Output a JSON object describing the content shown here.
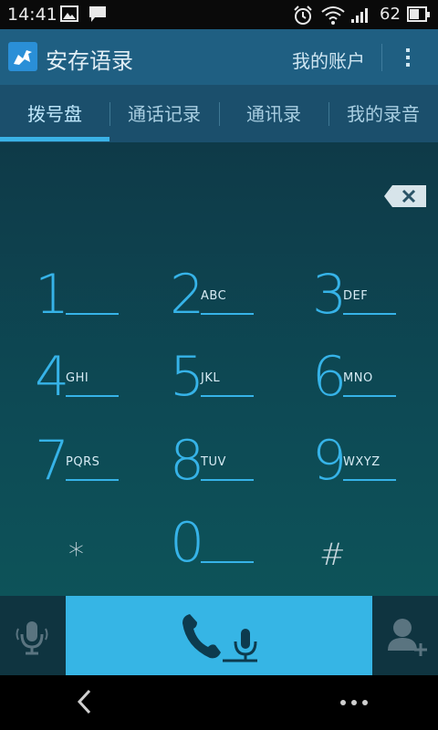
{
  "status_bar": {
    "time": "14:41",
    "battery": "62",
    "battery_level": 0.62
  },
  "app_bar": {
    "title": "安存语录",
    "account": "我的账户"
  },
  "tabs": [
    {
      "label": "拨号盘",
      "active": true
    },
    {
      "label": "通话记录",
      "active": false
    },
    {
      "label": "通讯录",
      "active": false
    },
    {
      "label": "我的录音",
      "active": false
    }
  ],
  "keypad": [
    {
      "digit": "1",
      "letters": ""
    },
    {
      "digit": "2",
      "letters": "ABC"
    },
    {
      "digit": "3",
      "letters": "DEF"
    },
    {
      "digit": "4",
      "letters": "GHI"
    },
    {
      "digit": "5",
      "letters": "JKL"
    },
    {
      "digit": "6",
      "letters": "MNO"
    },
    {
      "digit": "7",
      "letters": "PQRS"
    },
    {
      "digit": "8",
      "letters": "TUV"
    },
    {
      "digit": "9",
      "letters": "WXYZ"
    },
    {
      "digit": "*",
      "letters": ""
    },
    {
      "digit": "0",
      "letters": ""
    },
    {
      "digit": "#",
      "letters": ""
    }
  ],
  "icons": {
    "backspace": "backspace-icon",
    "voice": "microphone-icon",
    "call": "phone-record-icon",
    "add_contact": "add-contact-icon",
    "back": "back-icon",
    "menu": "more-icon"
  },
  "colors": {
    "accent": "#36b3e8",
    "app_bar": "#1f5f82",
    "tab_bar": "#1b4f6c",
    "call_button": "#36b5e5"
  }
}
